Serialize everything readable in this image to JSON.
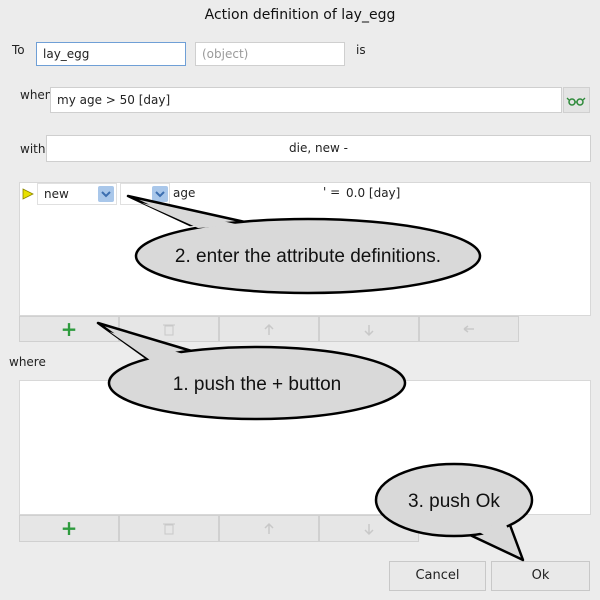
{
  "dialog": {
    "title": "Action definition of lay_egg"
  },
  "form": {
    "to_label": "To",
    "to_value": "lay_egg",
    "object_placeholder": "(object)",
    "is_label": "is",
    "when_label": "when",
    "when_value": "my age > 50 [day]",
    "with_label": "with",
    "with_value": "die, new -"
  },
  "attributes": {
    "rows": [
      {
        "object": "new",
        "qualifier": "",
        "attribute": "age",
        "operator": "' =",
        "value": "0.0 [day]"
      }
    ]
  },
  "where": {
    "label": "where"
  },
  "toolbar": {
    "add_label": "+",
    "delete_icon": "trash-icon",
    "up_icon": "arrow-up-icon",
    "down_icon": "arrow-down-icon",
    "undo_icon": "undo-icon"
  },
  "buttons": {
    "cancel": "Cancel",
    "ok": "Ok"
  },
  "callouts": {
    "step1": "1. push the + button",
    "step2": "2. enter the attribute definitions.",
    "step3": "3. push Ok"
  },
  "colors": {
    "accent_green": "#2e9b3e",
    "combo_arrow": "#a9c7ea",
    "row_marker": "#e8e000"
  }
}
